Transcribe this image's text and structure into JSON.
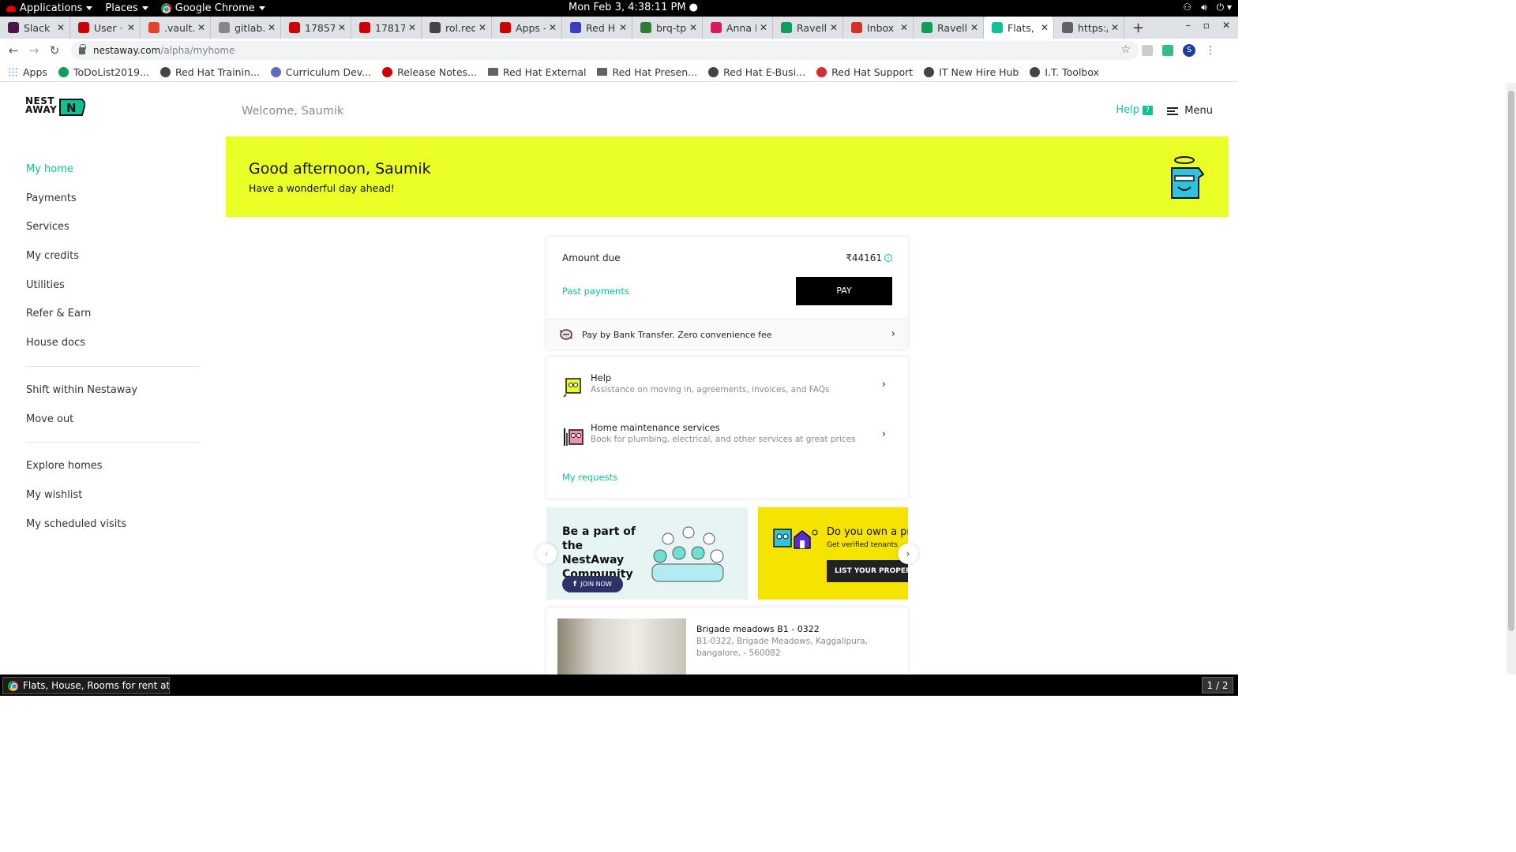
{
  "gnome": {
    "applications": "Applications",
    "places": "Places",
    "browser": "Google Chrome",
    "clock": "Mon Feb  3,  4:38:11 PM ●"
  },
  "tabs": [
    {
      "title": "Slack |",
      "color": "#4a154b"
    },
    {
      "title": "User ·",
      "color": "#cc0000"
    },
    {
      "title": ".vault..",
      "color": "#e24329"
    },
    {
      "title": "gitlab.c",
      "color": "#888888"
    },
    {
      "title": "17857",
      "color": "#cc0000"
    },
    {
      "title": "17817",
      "color": "#cc0000"
    },
    {
      "title": "rol.red",
      "color": "#444444"
    },
    {
      "title": "Apps -",
      "color": "#cc0000"
    },
    {
      "title": "Red Ha",
      "color": "#3c3cbe"
    },
    {
      "title": "brq-tpl",
      "color": "#2e7d32"
    },
    {
      "title": "Anna K",
      "color": "#d81b60"
    },
    {
      "title": "Ravello",
      "color": "#0f9d58"
    },
    {
      "title": "Inbox (",
      "color": "#d93025"
    },
    {
      "title": "Ravello",
      "color": "#0f9d58"
    },
    {
      "title": "Flats, I",
      "color": "#11c196",
      "active": true
    },
    {
      "title": "https:/",
      "color": "#5f6368"
    }
  ],
  "address": {
    "host": "nestaway.com",
    "path": "/alpha/myhome",
    "profile_initial": "S"
  },
  "bookmarks": [
    {
      "label": "Apps",
      "kind": "apps",
      "color": "#4285f4"
    },
    {
      "label": "ToDoList2019...",
      "kind": "icon",
      "color": "#0f9d58"
    },
    {
      "label": "Red Hat Trainin...",
      "kind": "icon",
      "color": "#444444"
    },
    {
      "label": "Curriculum Dev...",
      "kind": "icon",
      "color": "#5c6bc0"
    },
    {
      "label": "Release Notes...",
      "kind": "icon",
      "color": "#cc0000"
    },
    {
      "label": "Red Hat External",
      "kind": "folder",
      "color": "#5f6368"
    },
    {
      "label": "Red Hat Presen...",
      "kind": "folder",
      "color": "#5f6368"
    },
    {
      "label": "Red Hat E-Busi...",
      "kind": "icon",
      "color": "#444444"
    },
    {
      "label": "Red Hat Support",
      "kind": "icon",
      "color": "#d32f2f"
    },
    {
      "label": "IT New Hire Hub",
      "kind": "icon",
      "color": "#444444"
    },
    {
      "label": "I.T. Toolbox",
      "kind": "icon",
      "color": "#444444"
    }
  ],
  "brand": {
    "logo_line1": "NEST",
    "logo_line2": "AWAY",
    "accent": "#11c196",
    "banner_color": "#e9ff26"
  },
  "header": {
    "welcome": "Welcome, Saumik",
    "help": "Help",
    "help_badge": "?",
    "menu": "Menu"
  },
  "sidebar": {
    "group1": [
      "My home",
      "Payments",
      "Services",
      "My credits",
      "Utilities",
      "Refer & Earn",
      "House docs"
    ],
    "group2": [
      "Shift within Nestaway",
      "Move out"
    ],
    "group3": [
      "Explore homes",
      "My wishlist",
      "My scheduled visits"
    ]
  },
  "banner": {
    "greeting": "Good afternoon, Saumik",
    "subtitle": "Have a wonderful day ahead!"
  },
  "payment": {
    "amount_label": "Amount due",
    "amount_value": "₹44161",
    "past_payments": "Past payments",
    "pay": "PAY",
    "bank_transfer": "Pay by Bank Transfer. Zero convenience fee"
  },
  "support": {
    "help_title": "Help",
    "help_sub": "Assistance on moving in, agreements, invoices, and FAQs",
    "maint_title": "Home maintenance services",
    "maint_sub": "Book for plumbing, electrical, and other services at great prices",
    "my_requests": "My requests"
  },
  "promos": {
    "community_title": "Be a part of the NestAway Community",
    "join": "JOIN NOW",
    "owner_title": "Do you own a pr",
    "owner_sub": "Get verified tenants",
    "list_btn": "LIST YOUR PROPERT"
  },
  "property": {
    "name": "Brigade meadows B1 - 0322",
    "address": "B1-0322, Brigade Meadows, Kaggalipura, bangalore, - 560082"
  },
  "taskbar": {
    "window": "Flats, House, Rooms for rent at P...",
    "workspace": "1 / 2"
  }
}
